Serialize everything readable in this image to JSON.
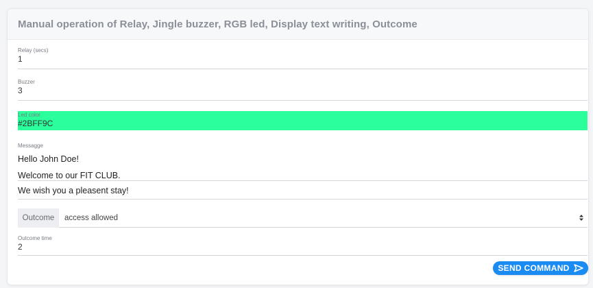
{
  "header": {
    "title": "Manual operation of Relay, Jingle buzzer, RGB led, Display text writing, Outcome"
  },
  "relay": {
    "label": "Relay (secs)",
    "value": "1"
  },
  "buzzer": {
    "label": "Buzzer",
    "value": "3"
  },
  "led": {
    "label": "Led color",
    "value": "#2BFF9C",
    "color": "#2BFF9C"
  },
  "message": {
    "label": "Messagge",
    "lines": [
      "Hello John Doe!",
      "Welcome to our FIT CLUB.",
      "We wish you a pleasent stay!"
    ]
  },
  "outcome": {
    "label": "Outcome",
    "selected": "access allowed"
  },
  "outcome_time": {
    "label": "Outcome time",
    "value": "2"
  },
  "send_button": {
    "label": "SEND COMMAND"
  },
  "colors": {
    "accent": "#1a8bf2",
    "led_background": "#2BFF9C"
  },
  "icons": {
    "send": "send-icon",
    "select_arrows": "sort-arrows-icon"
  }
}
